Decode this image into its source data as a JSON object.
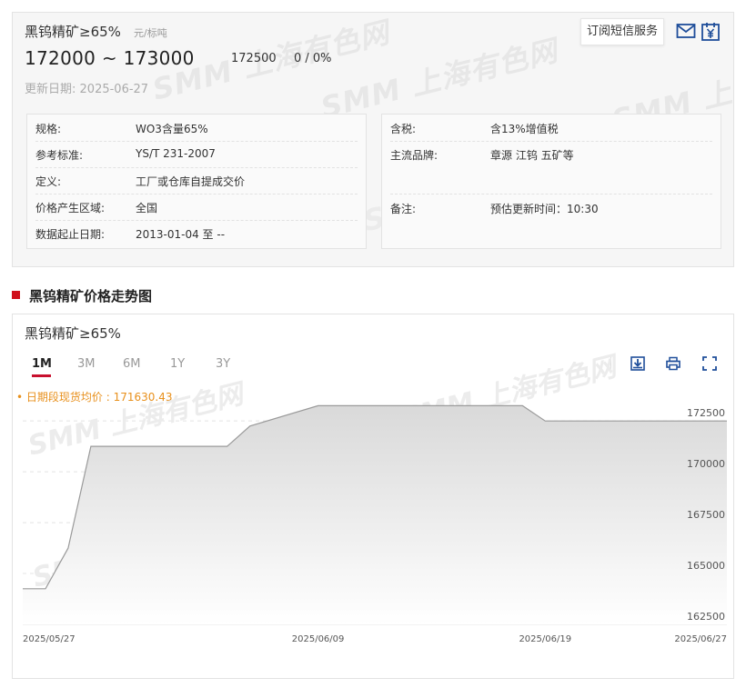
{
  "product": {
    "name": "黑钨精矿≥65%",
    "unit": "元/标吨",
    "price_low": "172000",
    "price_sep": "~",
    "price_high": "173000",
    "avg_price": "172500",
    "change": "0 / 0%",
    "update_label": "更新日期:",
    "update_date": "2025-06-27",
    "subscribe_label": "订阅短信服务"
  },
  "specs_left": [
    {
      "k": "规格:",
      "v": "WO3含量65%"
    },
    {
      "k": "参考标准:",
      "v": "YS/T 231-2007"
    },
    {
      "k": "定义:",
      "v": "工厂或仓库自提成交价"
    },
    {
      "k": "价格产生区域:",
      "v": "全国"
    },
    {
      "k": "数据起止日期:",
      "v": "2013-01-04 至 --"
    }
  ],
  "specs_right": [
    {
      "k": "含税:",
      "v": "含13%增值税"
    },
    {
      "k": "主流品牌:",
      "v": "章源 江钨 五矿等"
    },
    {
      "k": "",
      "v": ""
    },
    {
      "k": "备注:",
      "v": "预估更新时间：10:30"
    }
  ],
  "section_title": "黑钨精矿价格走势图",
  "chart_title": "黑钨精矿≥65%",
  "tabs": [
    "1M",
    "3M",
    "6M",
    "1Y",
    "3Y"
  ],
  "active_tab": "1M",
  "avg_label": "• 日期段现货均价 : 171630.43",
  "watermark": {
    "logo": "SMM",
    "text": "上海有色网"
  },
  "colors": {
    "accent": "#c8102e",
    "section_mark": "#d00f1b",
    "avg_label": "#e8901c",
    "icon_blue": "#1f4e9a"
  },
  "icons": [
    "mail-icon",
    "yuan-calendar-icon",
    "download-image-icon",
    "print-icon",
    "fullscreen-icon"
  ],
  "chart_data": {
    "type": "area",
    "title": "黑钨精矿≥65%",
    "x": [
      "2025-05-27",
      "2025-05-28",
      "2025-05-29",
      "2025-05-30",
      "2025-06-03",
      "2025-06-04",
      "2025-06-05",
      "2025-06-06",
      "2025-06-09",
      "2025-06-10",
      "2025-06-11",
      "2025-06-12",
      "2025-06-13",
      "2025-06-16",
      "2025-06-17",
      "2025-06-18",
      "2025-06-19",
      "2025-06-20",
      "2025-06-23",
      "2025-06-24",
      "2025-06-25",
      "2025-06-26",
      "2025-06-27"
    ],
    "series": [
      {
        "values": [
          164250,
          164250,
          166250,
          171250,
          171250,
          171250,
          171250,
          172250,
          173250,
          173250,
          173250,
          173250,
          173250,
          173250,
          173250,
          173250,
          172500,
          172500,
          172500,
          172500,
          172500,
          172500,
          172500
        ]
      }
    ],
    "x_tick_labels": [
      "2025/05/27",
      "2025/06/09",
      "2025/06/19",
      "2025/06/27"
    ],
    "x_tick_dates": [
      "2025-05-27",
      "2025-06-09",
      "2025-06-19",
      "2025-06-27"
    ],
    "y_ticks": [
      162500,
      165000,
      167500,
      170000,
      172500
    ],
    "ylim": [
      162500,
      174250
    ],
    "grid": true,
    "y_axis_side": "right"
  }
}
